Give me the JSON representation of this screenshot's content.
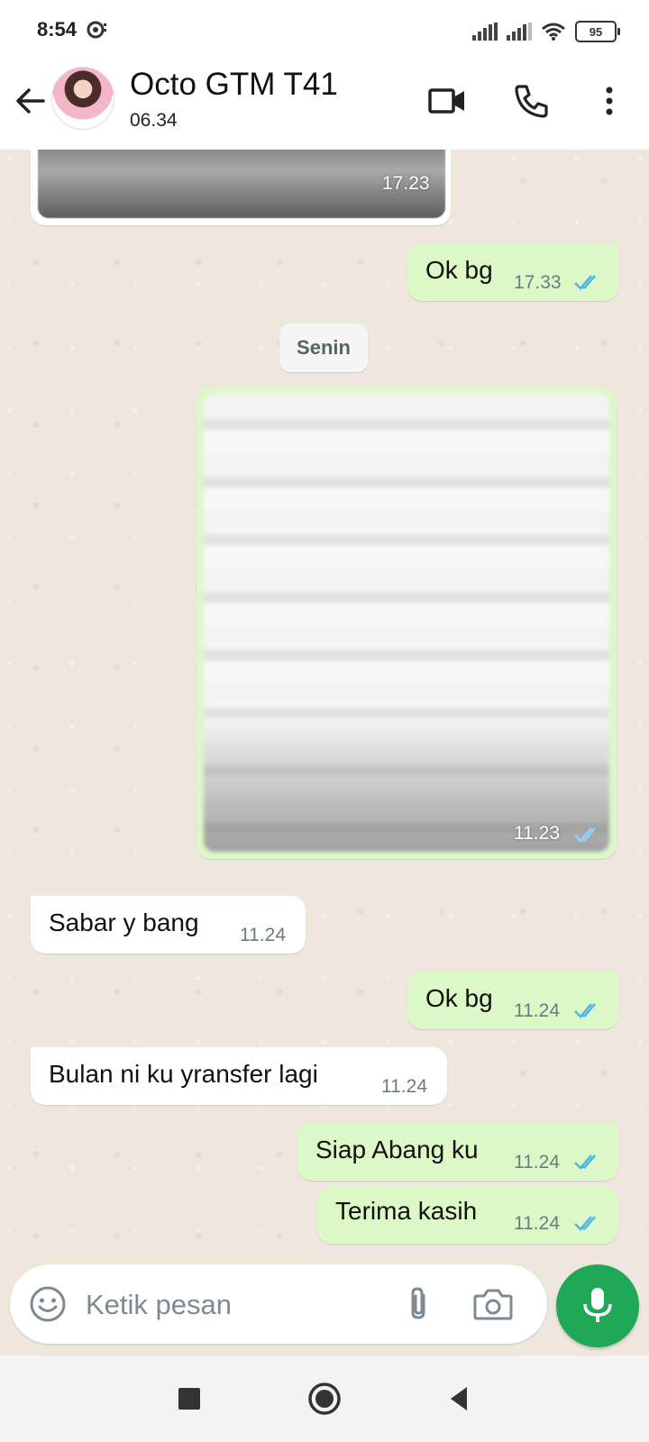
{
  "status_bar": {
    "time": "8:54",
    "battery": "95"
  },
  "header": {
    "contact_name": "Octo GTM T41",
    "last_seen": "06.34"
  },
  "chat": {
    "top_media_time": "17.23",
    "msg_ok_1": {
      "text": "Ok bg",
      "time": "17.33"
    },
    "date_separator": "Senin",
    "media_out_time": "11.23",
    "msg_sabar": {
      "text": "Sabar y bang",
      "time": "11.24"
    },
    "msg_ok_2": {
      "text": "Ok bg",
      "time": "11.24"
    },
    "msg_bulan": {
      "text": "Bulan ni ku yransfer lagi",
      "time": "11.24"
    },
    "msg_siap": {
      "text": "Siap Abang ku",
      "time": "11.24"
    },
    "msg_terima": {
      "text": "Terima kasih",
      "time": "11.24"
    }
  },
  "composer": {
    "placeholder": "Ketik pesan"
  },
  "colors": {
    "accent_green": "#1fa855",
    "outgoing_bubble": "#dcf8c6",
    "read_ticks": "#4fb6ec",
    "chat_background": "#efe7de"
  },
  "icons": {
    "back": "arrow-left-icon",
    "video": "video-camera-icon",
    "call": "phone-icon",
    "menu": "more-vertical-icon",
    "emoji": "emoji-icon",
    "attach": "paperclip-icon",
    "camera": "camera-icon",
    "mic": "microphone-icon"
  }
}
